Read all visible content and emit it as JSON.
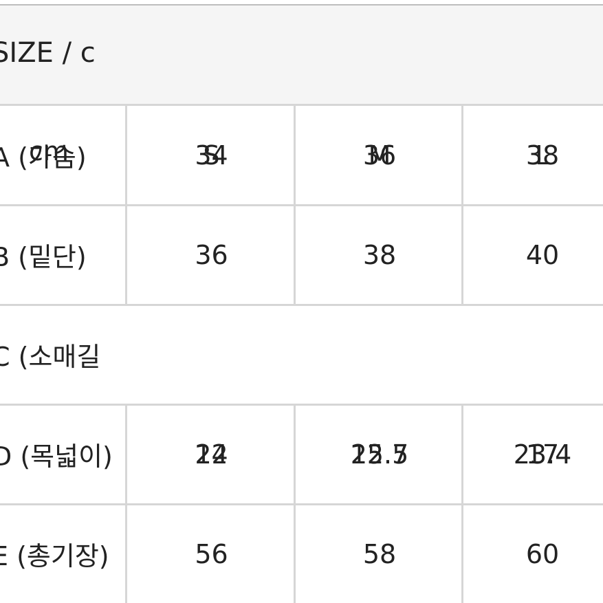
{
  "header": {
    "title": "SIZE / c"
  },
  "rows": [
    {
      "label": "A (가슴)",
      "overlay_label": "cm",
      "values": [
        "34",
        "36",
        "38"
      ],
      "overlay_values": [
        "S",
        "M",
        "L"
      ]
    },
    {
      "label": "B (밑단)",
      "values": [
        "36",
        "38",
        "40"
      ]
    },
    {
      "label": "C (소매길"
    },
    {
      "label": "D (목넓이)",
      "values": [
        "22",
        "22.7",
        "23.4"
      ],
      "overlay_values": [
        "14",
        "15.5",
        "17"
      ]
    },
    {
      "label": "E (총기장)",
      "values": [
        "56",
        "58",
        "60"
      ]
    }
  ]
}
